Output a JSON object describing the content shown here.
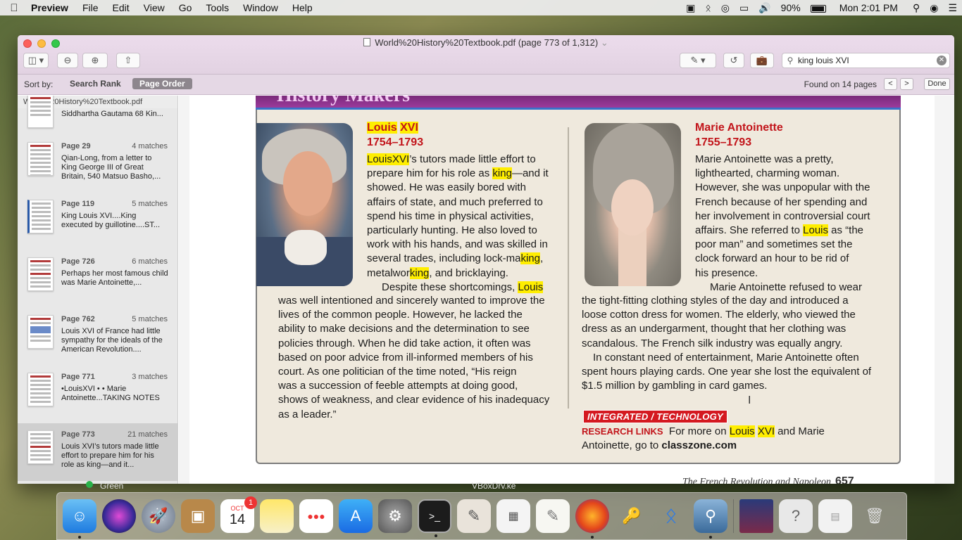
{
  "menubar": {
    "app": "Preview",
    "items": [
      "File",
      "Edit",
      "View",
      "Go",
      "Tools",
      "Window",
      "Help"
    ],
    "battery": "90%",
    "clock": "Mon 2:01 PM"
  },
  "window": {
    "title": "World%20History%20Textbook.pdf (page 773 of 1,312)",
    "search_value": "king louis XVI"
  },
  "sortbar": {
    "label": "Sort by:",
    "option_rank": "Search Rank",
    "option_order": "Page Order",
    "found": "Found on 14 pages",
    "prev": "<",
    "next": ">",
    "done": "Done"
  },
  "sidebar": {
    "header": "World%20History%20Textbook.pdf",
    "first_snippet": "Siddhartha Gautama 68 Kin...",
    "results": [
      {
        "page": "Page 29",
        "matches": "4 matches",
        "snippet": "Qian-Long, from a letter to King George III of Great Britain, 540 Matsuo Basho,..."
      },
      {
        "page": "Page 119",
        "matches": "5 matches",
        "snippet": "King Louis XVI....King executed by guillotine....ST..."
      },
      {
        "page": "Page 726",
        "matches": "6 matches",
        "snippet": "Perhaps her most famous child was Marie Antoinette,..."
      },
      {
        "page": "Page 762",
        "matches": "5 matches",
        "snippet": "Louis XVI of France had little sympathy for the ideals of the American Revolution...."
      },
      {
        "page": "Page 771",
        "matches": "3 matches",
        "snippet": "•LouisXVI • • Marie Antoinette...TAKING NOTES"
      },
      {
        "page": "Page 773",
        "matches": "21 matches",
        "snippet": "Louis XVI’s tutors made little effort to prepare him for his role as king—and it..."
      }
    ]
  },
  "document": {
    "banner": "History Makers",
    "louis": {
      "name_a": "Louis",
      "name_b": "XVI",
      "dates": "1754–1793",
      "p1": "’s tutors made little effort to",
      "lines": [
        "prepare him for his role as ",
        "—and it",
        "showed. He was easily bored with",
        "affairs of state, and much preferred to",
        "spend his time in physical activities,",
        "particularly hunting. He also loved to",
        "work with his hands, and was skilled in",
        "several trades, including lock-ma",
        ",",
        "metalwor",
        ", and bricklaying.",
        "Despite these shortcomings, ",
        "was well intentioned and sincerely wanted to improve the",
        "lives of the common people. However, he lacked the",
        "ability to make decisions and the determination to see",
        "policies through. When he did take action, it often was",
        "based on poor advice from ill-informed members of his",
        "court. As one politician of the time noted, “His reign",
        "was a succession of feeble attempts at doing good,",
        "shows of weakness, and clear evidence of his inadequacy",
        "as a leader.”"
      ],
      "hl_king": "king",
      "hl_louis": "Louis"
    },
    "marie": {
      "name": "Marie Antoinette",
      "dates": "1755–1793",
      "lines": [
        "Marie Antoinette was a pretty,",
        "lighthearted, charming woman.",
        "However, she was unpopular with the",
        "French because of her spending and",
        "her involvement in controversial court",
        "affairs. She referred to ",
        " as “the",
        "poor man” and sometimes set the",
        "clock forward an hour to be rid of",
        "his presence.",
        "Marie Antoinette refused to wear",
        "the tight-fitting clothing styles of the day and introduced a",
        "loose cotton dress for women. The elderly, who viewed the",
        "dress as an undergarment, thought that her clothing was",
        "scandalous. The French silk industry was equally angry.",
        "In constant need of entertainment, Marie Antoinette often",
        "spent hours playing cards. One year she lost the equivalent of",
        "$1.5 million by gambling in card games."
      ]
    },
    "badge_a": "INTEGRATED",
    "badge_b": "TECHNOLOGY",
    "research_label": "RESEARCH LINKS",
    "research_a": "For more on ",
    "research_b": " and Marie",
    "research_c": "Antoinette, go to ",
    "research_link": "classzone.com",
    "footer": "The French Revolution and Napoleon",
    "page_number": "657"
  },
  "under_window": {
    "left": "Green",
    "right": "VBoxDrv.ke"
  },
  "dock": {
    "calendar_month": "OCT",
    "calendar_day": "14",
    "calendar_badge": "1"
  }
}
